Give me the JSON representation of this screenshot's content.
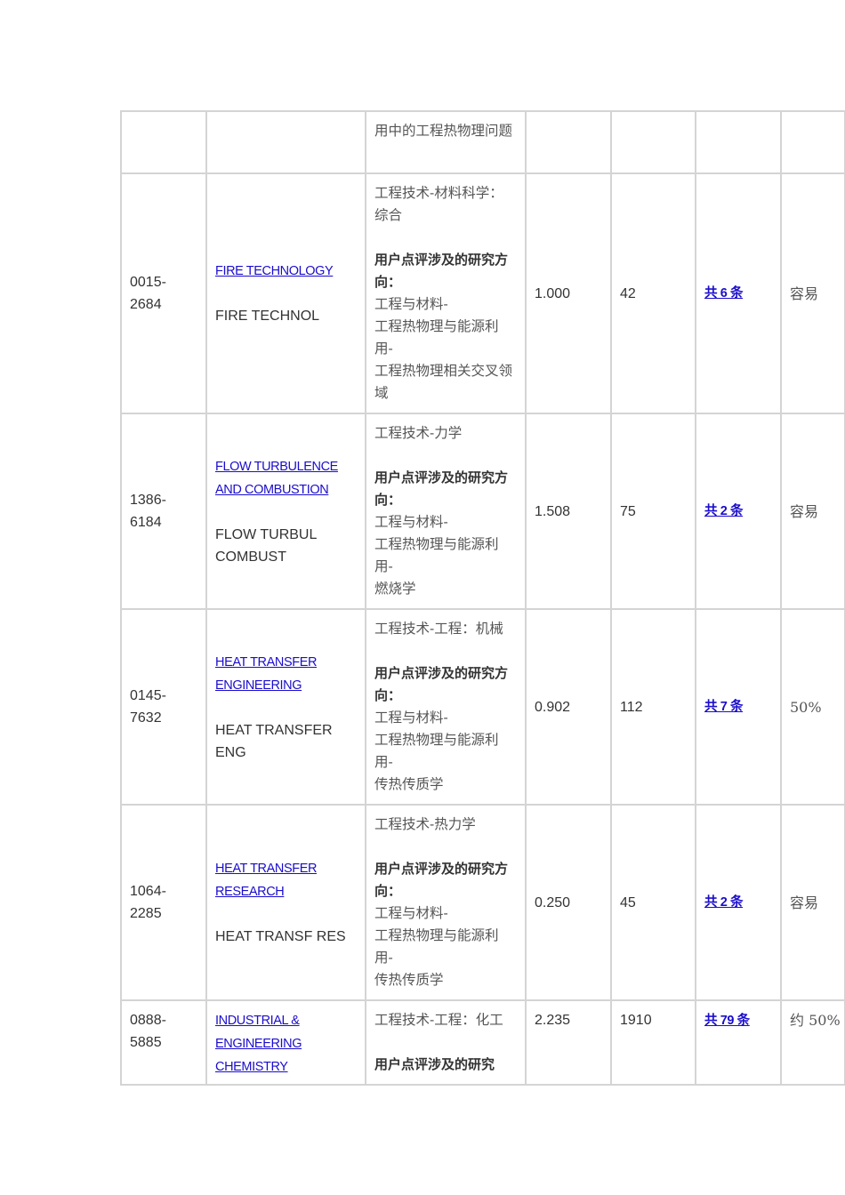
{
  "rows": [
    {
      "issn": "",
      "title_link": "",
      "abbr": "",
      "subject": [
        "用中的工程热物理问题"
      ],
      "if": "",
      "count": "",
      "reviews": "",
      "difficulty": ""
    },
    {
      "issn": "0015-2684",
      "title_link": "FIRE TECHNOLOGY",
      "abbr": "FIRE TECHNOL",
      "subject": [
        "工程技术-材料科学：综合",
        "",
        "**用户点评涉及的研究方向：",
        "工程与材料-",
        "工程热物理与能源利用-",
        "工程热物理相关交叉领域"
      ],
      "if": "1.000",
      "count": "42",
      "reviews": "共 6 条",
      "difficulty": "容易"
    },
    {
      "issn": "1386-6184",
      "title_link": "FLOW TURBULENCE AND COMBUSTION",
      "abbr": "FLOW TURBUL COMBUST",
      "subject": [
        "工程技术-力学",
        "",
        "**用户点评涉及的研究方向：",
        "工程与材料-",
        "工程热物理与能源利用-",
        "燃烧学"
      ],
      "if": "1.508",
      "count": "75",
      "reviews": "共 2 条",
      "difficulty": "容易"
    },
    {
      "issn": "0145-7632",
      "title_link": "HEAT TRANSFER ENGINEERING",
      "abbr": "HEAT TRANSFER ENG",
      "subject": [
        "工程技术-工程：机械",
        "",
        "**用户点评涉及的研究方向：",
        "工程与材料-",
        "工程热物理与能源利用-",
        "传热传质学"
      ],
      "if": "0.902",
      "count": "112",
      "reviews": "共 7 条",
      "difficulty": "50%"
    },
    {
      "issn": "1064-2285",
      "title_link": "HEAT TRANSFER RESEARCH",
      "abbr": "HEAT TRANSF RES",
      "subject": [
        "工程技术-热力学",
        "",
        "**用户点评涉及的研究方向：",
        "工程与材料-",
        "工程热物理与能源利用-",
        "传热传质学"
      ],
      "if": "0.250",
      "count": "45",
      "reviews": "共 2 条",
      "difficulty": "容易"
    },
    {
      "issn": "0888-5885",
      "title_link": "INDUSTRIAL & ENGINEERING CHEMISTRY",
      "abbr": "",
      "subject": [
        "工程技术-工程：化工",
        "",
        "**用户点评涉及的研究"
      ],
      "if": "2.235",
      "count": "1910",
      "reviews": "共 79 条",
      "difficulty": "约 50%"
    }
  ]
}
